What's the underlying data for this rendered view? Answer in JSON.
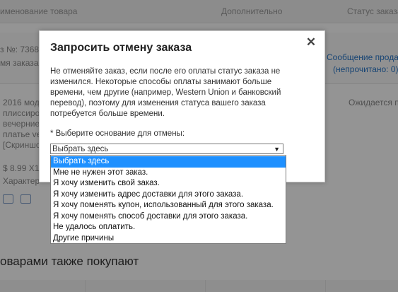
{
  "background": {
    "header": {
      "col_product": "именование товара",
      "col_extra": "Дополнительно",
      "col_status": "Статус заказа"
    },
    "order": {
      "number_label": "з №: 7368",
      "date_label": "мя заказа:",
      "message_link": "Сообщение прода",
      "unread_link": "(непрочитано: 0)"
    },
    "item": {
      "desc_lines": [
        "2016 мод",
        "плиссиро",
        "вечерние",
        "платье ve",
        "[Скриншо"
      ],
      "price": "$ 8.99 X1",
      "attributes": "Характер",
      "status": "Ожидается п"
    },
    "section_heading": "оварами также покупают"
  },
  "modal": {
    "title": "Запросить отмену заказа",
    "close_glyph": "✕",
    "notice": "Не отменяйте заказ, если после его оплаты статус заказа не изменился. Некоторые способы оплаты занимают больше времени, чем другие (например, Western Union и банковский перевод), поэтому для изменения статуса вашего заказа потребуется больше времени.",
    "reason_label": "* Выберите основание для отмены:",
    "select_value": "Выбрать здесь",
    "select_arrow": "▼"
  },
  "dropdown": {
    "options": [
      "Выбрать здесь",
      "Мне не нужен этот заказ.",
      "Я хочу изменить свой заказ.",
      "Я хочу изменить адрес доставки для этого заказа.",
      "Я хочу поменять купон, использованный для этого заказа.",
      "Я хочу поменять способ доставки для этого заказа.",
      "Не удалось оплатить.",
      "Другие причины"
    ],
    "selected_index": 0
  },
  "colors": {
    "overlay": "#000000",
    "selected_option": "#1e90ff",
    "link": "#2a77c8"
  }
}
